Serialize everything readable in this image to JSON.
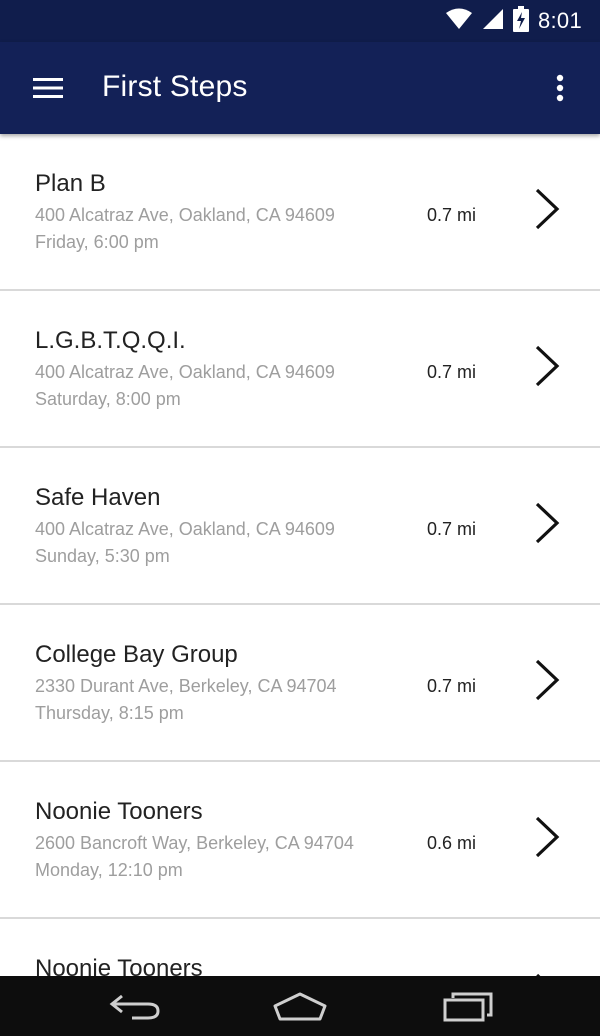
{
  "status_bar": {
    "time": "8:01",
    "icons": [
      "wifi-icon",
      "cell-signal-icon",
      "battery-charging-icon"
    ]
  },
  "app_bar": {
    "title": "First Steps",
    "menu_icon": "hamburger-menu-icon",
    "overflow_icon": "more-vert-icon"
  },
  "meetings": [
    {
      "name": "Plan B",
      "address": "400 Alcatraz Ave, Oakland, CA 94609",
      "time": "Friday, 6:00 pm",
      "distance": "0.7 mi"
    },
    {
      "name": "L.G.B.T.Q.Q.I.",
      "address": "400 Alcatraz Ave, Oakland, CA 94609",
      "time": "Saturday, 8:00 pm",
      "distance": "0.7 mi"
    },
    {
      "name": "Safe Haven",
      "address": "400 Alcatraz Ave, Oakland, CA 94609",
      "time": "Sunday, 5:30 pm",
      "distance": "0.7 mi"
    },
    {
      "name": "College Bay Group",
      "address": "2330 Durant Ave, Berkeley, CA 94704",
      "time": "Thursday, 8:15 pm",
      "distance": "0.7 mi"
    },
    {
      "name": "Noonie Tooners",
      "address": "2600 Bancroft Way, Berkeley, CA 94704",
      "time": "Monday, 12:10 pm",
      "distance": "0.6 mi"
    },
    {
      "name": "Noonie Tooners",
      "address": "",
      "time": "",
      "distance": ""
    }
  ],
  "nav_bar": {
    "icons": [
      "back-icon",
      "home-icon",
      "recents-icon"
    ]
  },
  "colors": {
    "status_bar": "#101d4c",
    "app_bar": "#132157",
    "nav_bar": "#0d0d0d",
    "divider": "#d9d9d9",
    "secondary_text": "#9e9e9e"
  }
}
